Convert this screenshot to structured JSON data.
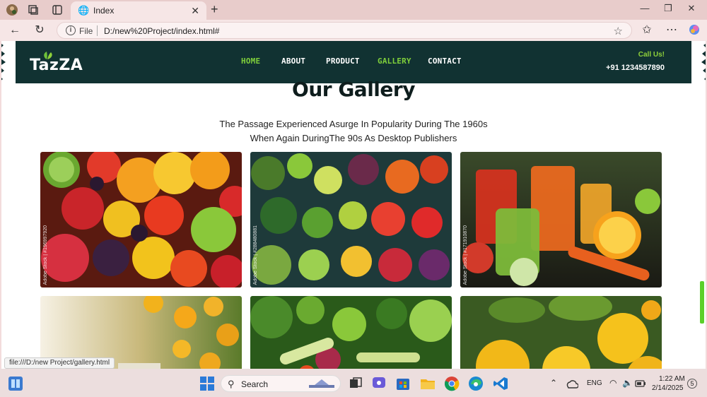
{
  "browser": {
    "tab_title": "Index",
    "url_scheme_label": "File",
    "url": "D:/new%20Project/index.html#"
  },
  "site": {
    "logo": "TazZA",
    "nav": [
      {
        "label": "HOME",
        "active": true
      },
      {
        "label": "ABOUT",
        "active": false
      },
      {
        "label": "PRODUCT",
        "active": false
      },
      {
        "label": "GALLERY",
        "active": true
      },
      {
        "label": "CONTACT",
        "active": false
      }
    ],
    "call_label": "Call Us!",
    "call_number": "+91 1234587890",
    "accent_color": "#7fcf3b",
    "header_color": "#113232"
  },
  "gallery": {
    "title": "Our Gallery",
    "subtitle": "The Passage Experienced Asurge In Popularity During The 1960s When Again DuringThe 90s As Desktop Publishers",
    "images": [
      {
        "name": "mixed-fruits",
        "watermark": "Adobe Stock | #196997920"
      },
      {
        "name": "fruits-and-vegetables",
        "watermark": "Adobe Stock | #288480881"
      },
      {
        "name": "juices",
        "watermark": "Adobe Stock | #171910870"
      },
      {
        "name": "orange-tree",
        "watermark": ""
      },
      {
        "name": "green-vegetables",
        "watermark": ""
      },
      {
        "name": "lemons",
        "watermark": ""
      }
    ]
  },
  "statusbar": {
    "link": "file:///D:/new Project/gallery.html"
  },
  "taskbar": {
    "search_label": "Search",
    "language": "ENG",
    "time": "1:22 AM",
    "date": "2/14/2025",
    "notification_count": "5"
  }
}
